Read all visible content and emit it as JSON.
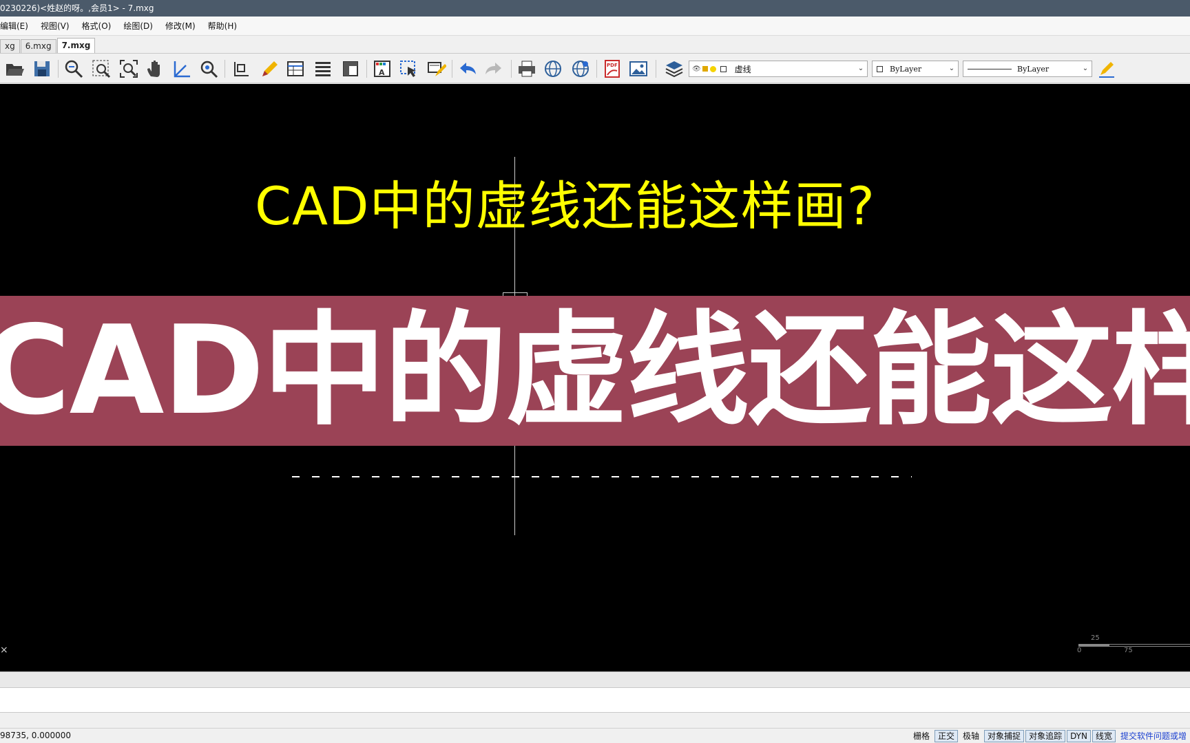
{
  "titlebar": {
    "text": "0230226)<姓赵的呀。,会员1> - 7.mxg"
  },
  "menu": [
    {
      "label": "编辑(E)"
    },
    {
      "label": "视图(V)"
    },
    {
      "label": "格式(O)"
    },
    {
      "label": "绘图(D)"
    },
    {
      "label": "修改(M)"
    },
    {
      "label": "帮助(H)"
    }
  ],
  "tabs": [
    {
      "label": "xg"
    },
    {
      "label": "6.mxg"
    },
    {
      "label": "7.mxg",
      "active": true
    }
  ],
  "toolbar": {
    "layer_combo": {
      "value": "虚线"
    },
    "color_combo": {
      "value": "ByLayer"
    },
    "linetype_combo": {
      "value": "ByLayer"
    }
  },
  "drawing": {
    "title_text": "CAD中的虚线还能这样画?",
    "banner_text": "CAD中的虚线还能这样画?",
    "scale_top": "25",
    "scale_left": "0",
    "scale_right": "75",
    "ucs_mark": "×"
  },
  "statusbar": {
    "coords": "98735,  0.000000",
    "buttons": [
      {
        "label": "栅格",
        "on": false
      },
      {
        "label": "正交",
        "on": true
      },
      {
        "label": "极轴",
        "on": false
      },
      {
        "label": "对象捕捉",
        "on": true
      },
      {
        "label": "对象追踪",
        "on": true
      },
      {
        "label": "DYN",
        "on": true
      },
      {
        "label": "线宽",
        "on": true
      }
    ],
    "feedback_link": "提交软件问题或增"
  },
  "colors": {
    "canvas": "#000000",
    "cad_text": "#ffff00",
    "banner": "#9b4356",
    "titlebar": "#4b5a6a"
  }
}
